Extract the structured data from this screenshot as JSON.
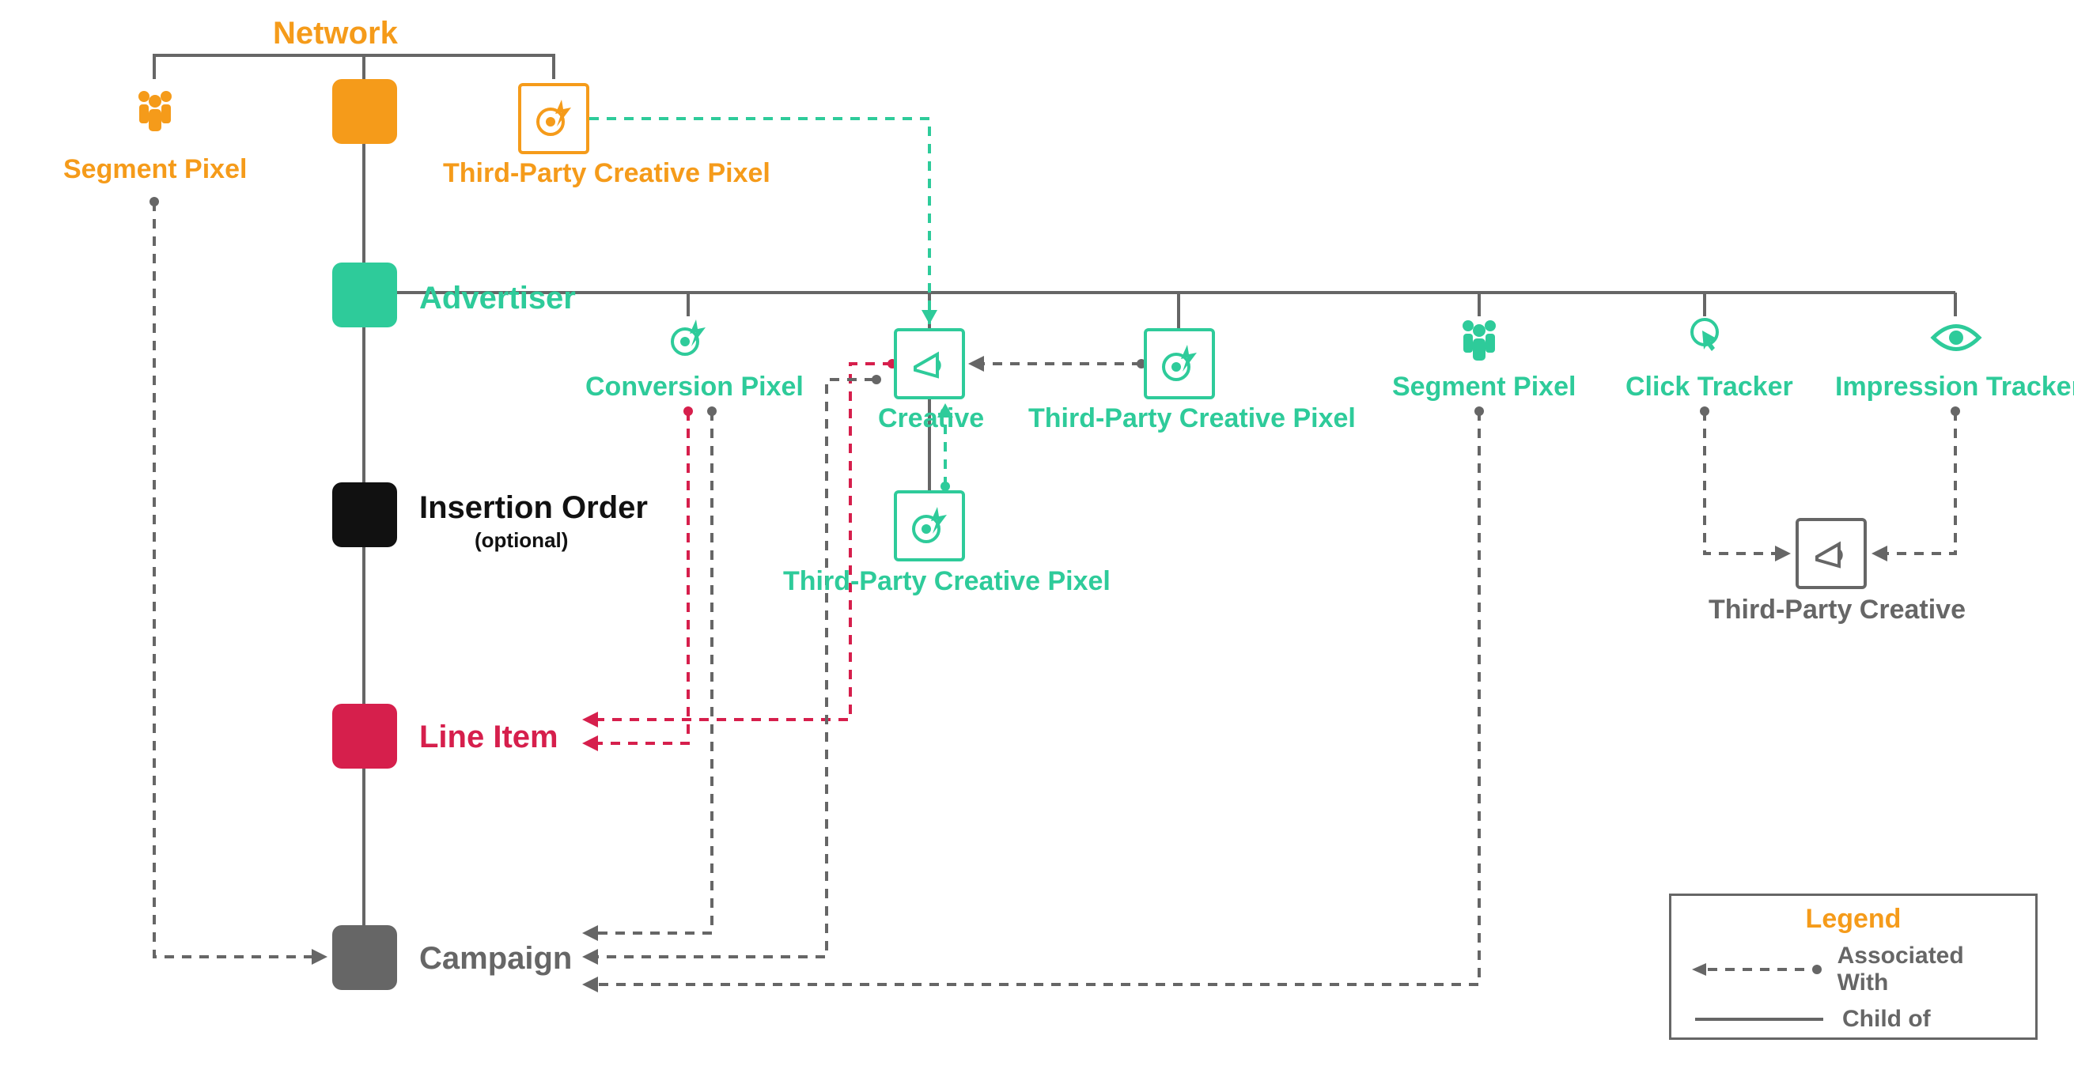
{
  "colors": {
    "orange": "#f59b1a",
    "green": "#2ecb9a",
    "black": "#111111",
    "red": "#d61f4c",
    "gray": "#666666"
  },
  "hierarchy": {
    "network": {
      "label": "Network",
      "sublabel": ""
    },
    "advertiser": {
      "label": "Advertiser",
      "sublabel": ""
    },
    "insertion_order": {
      "label": "Insertion Order",
      "sublabel": "(optional)"
    },
    "line_item": {
      "label": "Line Item",
      "sublabel": ""
    },
    "campaign": {
      "label": "Campaign",
      "sublabel": ""
    }
  },
  "network_children": {
    "segment_pixel": {
      "label": "Segment Pixel"
    },
    "tp_creative_pixel": {
      "label": "Third-Party Creative Pixel"
    }
  },
  "advertiser_children": {
    "conversion_pixel": {
      "label": "Conversion Pixel"
    },
    "creative": {
      "label": "Creative"
    },
    "tp_creative_pixel": {
      "label": "Third-Party Creative Pixel"
    },
    "segment_pixel": {
      "label": "Segment Pixel"
    },
    "click_tracker": {
      "label": "Click Tracker"
    },
    "impression_tracker": {
      "label": "Impression Tracker"
    }
  },
  "creative_children": {
    "tp_creative_pixel": {
      "label": "Third-Party Creative Pixel"
    }
  },
  "tracker_target": {
    "third_party_creative": {
      "label": "Third-Party Creative"
    }
  },
  "legend": {
    "title": "Legend",
    "associated": "Associated With",
    "child_of": "Child of"
  },
  "diagram": {
    "relationships": [
      {
        "from": "Network",
        "to": "Segment Pixel",
        "type": "child_of"
      },
      {
        "from": "Network",
        "to": "Third-Party Creative Pixel (network)",
        "type": "child_of"
      },
      {
        "from": "Network",
        "to": "Advertiser",
        "type": "child_of"
      },
      {
        "from": "Advertiser",
        "to": "Conversion Pixel",
        "type": "child_of"
      },
      {
        "from": "Advertiser",
        "to": "Creative",
        "type": "child_of"
      },
      {
        "from": "Advertiser",
        "to": "Third-Party Creative Pixel (advertiser)",
        "type": "child_of"
      },
      {
        "from": "Advertiser",
        "to": "Segment Pixel (advertiser)",
        "type": "child_of"
      },
      {
        "from": "Advertiser",
        "to": "Click Tracker",
        "type": "child_of"
      },
      {
        "from": "Advertiser",
        "to": "Impression Tracker",
        "type": "child_of"
      },
      {
        "from": "Advertiser",
        "to": "Insertion Order",
        "type": "child_of"
      },
      {
        "from": "Insertion Order",
        "to": "Line Item",
        "type": "child_of"
      },
      {
        "from": "Line Item",
        "to": "Campaign",
        "type": "child_of"
      },
      {
        "from": "Creative",
        "to": "Third-Party Creative Pixel (creative)",
        "type": "child_of"
      },
      {
        "from": "Third-Party Creative Pixel (network)",
        "to": "Creative",
        "type": "associated_with"
      },
      {
        "from": "Third-Party Creative Pixel (advertiser)",
        "to": "Creative",
        "type": "associated_with"
      },
      {
        "from": "Third-Party Creative Pixel (creative)",
        "to": "Creative",
        "type": "associated_with"
      },
      {
        "from": "Conversion Pixel",
        "to": "Line Item",
        "type": "associated_with"
      },
      {
        "from": "Creative",
        "to": "Line Item",
        "type": "associated_with"
      },
      {
        "from": "Segment Pixel (network)",
        "to": "Campaign",
        "type": "associated_with"
      },
      {
        "from": "Conversion Pixel",
        "to": "Campaign",
        "type": "associated_with"
      },
      {
        "from": "Creative",
        "to": "Campaign",
        "type": "associated_with"
      },
      {
        "from": "Segment Pixel (advertiser)",
        "to": "Campaign",
        "type": "associated_with"
      },
      {
        "from": "Click Tracker",
        "to": "Third-Party Creative",
        "type": "associated_with"
      },
      {
        "from": "Impression Tracker",
        "to": "Third-Party Creative",
        "type": "associated_with"
      }
    ]
  }
}
